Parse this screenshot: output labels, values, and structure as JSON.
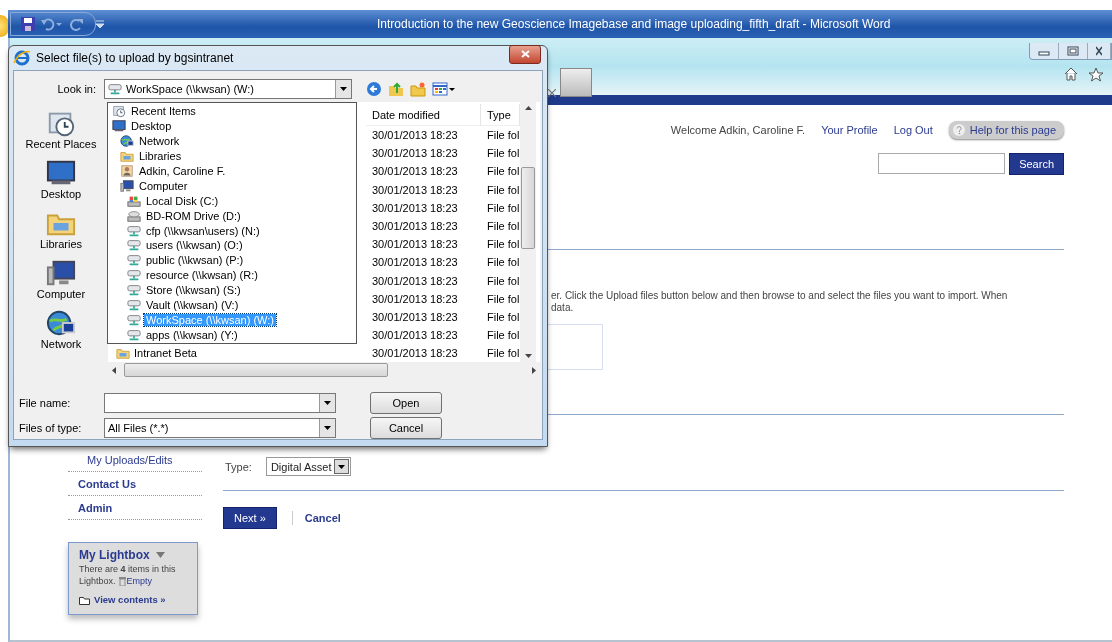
{
  "word_window": {
    "title": "Introduction to the new Geoscience Imagebase and image uploading_fifth_draft  -  Microsoft Word"
  },
  "browser": {
    "header": {
      "welcome": "Welcome Adkin, Caroline F.",
      "links": [
        "Your Profile",
        "Log Out"
      ],
      "help": "Help for this page",
      "search_button": "Search"
    },
    "intro_lines": [
      "er. Click the Upload files button below and then browse to and select the files you want to import. When",
      "data."
    ],
    "type_field": {
      "label": "Type:",
      "value": "Digital Asset"
    },
    "actions": {
      "next": "Next »",
      "cancel": "Cancel"
    },
    "nav": [
      {
        "label": "My Uploads/Edits",
        "kind": "sub"
      },
      {
        "label": "Contact Us",
        "kind": "top"
      },
      {
        "label": "Admin",
        "kind": "top"
      }
    ],
    "lightbox": {
      "title": "My Lightbox",
      "text_lines": [
        "There are **4** items in this",
        "Lightbox."
      ],
      "empty": "Empty",
      "view": "View contents »"
    }
  },
  "dialog": {
    "title": "Select file(s) to upload by bgsintranet",
    "look_in": {
      "label": "Look in:",
      "value": "WorkSpace (\\\\kwsan) (W:)"
    },
    "places": [
      {
        "label": "Recent Places",
        "kind": "recent"
      },
      {
        "label": "Desktop",
        "kind": "desktop"
      },
      {
        "label": "Libraries",
        "kind": "libraries"
      },
      {
        "label": "Computer",
        "kind": "computer"
      },
      {
        "label": "Network",
        "kind": "network"
      }
    ],
    "location_list": [
      {
        "label": "Recent Items",
        "kind": "recent",
        "selected": false
      },
      {
        "label": "Desktop",
        "kind": "desktop",
        "selected": false,
        "children": [
          {
            "label": "Network",
            "kind": "network",
            "selected": false
          },
          {
            "label": "Libraries",
            "kind": "libraries",
            "selected": false
          },
          {
            "label": "Adkin, Caroline F.",
            "kind": "user",
            "selected": false
          },
          {
            "label": "Computer",
            "kind": "computer",
            "selected": false,
            "children": [
              {
                "label": "Local Disk (C:)",
                "kind": "local-disk",
                "selected": false
              },
              {
                "label": "BD-ROM Drive (D:)",
                "kind": "optical",
                "selected": false
              },
              {
                "label": "cfp (\\\\kwsan\\users) (N:)",
                "kind": "network-drive",
                "selected": false
              },
              {
                "label": "users (\\\\kwsan) (O:)",
                "kind": "network-drive",
                "selected": false
              },
              {
                "label": "public (\\\\kwsan) (P:)",
                "kind": "network-drive",
                "selected": false
              },
              {
                "label": "resource (\\\\kwsan) (R:)",
                "kind": "network-drive",
                "selected": false
              },
              {
                "label": "Store (\\\\kwsan) (S:)",
                "kind": "network-drive",
                "selected": false
              },
              {
                "label": "Vault (\\\\kwsan) (V:)",
                "kind": "network-drive",
                "selected": false
              },
              {
                "label": "WorkSpace (\\\\kwsan) (W:)",
                "kind": "network-drive",
                "selected": true
              },
              {
                "label": "apps (\\\\kwsan) (Y:)",
                "kind": "network-drive",
                "selected": false
              }
            ]
          }
        ]
      }
    ],
    "file_list": {
      "columns": [
        "Date modified",
        "Type"
      ],
      "behind_item": "Intranet Beta",
      "rows": [
        {
          "date": "30/01/2013 18:23",
          "type": "File fol"
        },
        {
          "date": "30/01/2013 18:23",
          "type": "File fol"
        },
        {
          "date": "30/01/2013 18:23",
          "type": "File fol"
        },
        {
          "date": "30/01/2013 18:23",
          "type": "File fol"
        },
        {
          "date": "30/01/2013 18:23",
          "type": "File fol"
        },
        {
          "date": "30/01/2013 18:23",
          "type": "File fol"
        },
        {
          "date": "30/01/2013 18:23",
          "type": "File fol"
        },
        {
          "date": "30/01/2013 18:23",
          "type": "File fol"
        },
        {
          "date": "30/01/2013 18:23",
          "type": "File fol"
        },
        {
          "date": "30/01/2013 18:23",
          "type": "File fol"
        },
        {
          "date": "30/01/2013 18:23",
          "type": "File fol"
        },
        {
          "date": "30/01/2013 18:23",
          "type": "File fol"
        },
        {
          "date": "30/01/2013 18:23",
          "type": "File fol"
        }
      ]
    },
    "file_name": {
      "label": "File name:"
    },
    "files_of_type": {
      "label": "Files of type:",
      "value": "All Files (*.*)"
    },
    "buttons": [
      "Open",
      "Cancel"
    ]
  }
}
